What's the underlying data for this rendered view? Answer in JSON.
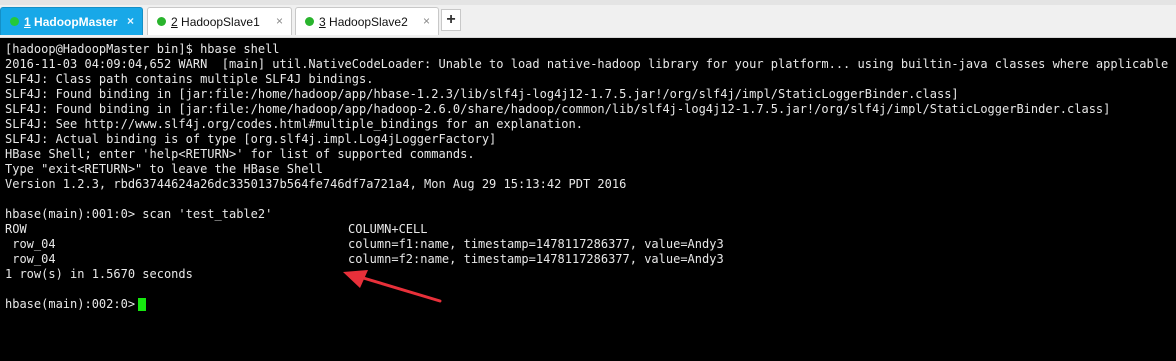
{
  "tabs": [
    {
      "num": "1",
      "name": " HadoopMaster"
    },
    {
      "num": "2",
      "name": " HadoopSlave1"
    },
    {
      "num": "3",
      "name": " HadoopSlave2"
    }
  ],
  "tab_close": "×",
  "new_tab": "+",
  "terminal": {
    "lines": [
      "[hadoop@HadoopMaster bin]$ hbase shell",
      "2016-11-03 04:09:04,652 WARN  [main] util.NativeCodeLoader: Unable to load native-hadoop library for your platform... using builtin-java classes where applicable",
      "SLF4J: Class path contains multiple SLF4J bindings.",
      "SLF4J: Found binding in [jar:file:/home/hadoop/app/hbase-1.2.3/lib/slf4j-log4j12-1.7.5.jar!/org/slf4j/impl/StaticLoggerBinder.class]",
      "SLF4J: Found binding in [jar:file:/home/hadoop/app/hadoop-2.6.0/share/hadoop/common/lib/slf4j-log4j12-1.7.5.jar!/org/slf4j/impl/StaticLoggerBinder.class]",
      "SLF4J: See http://www.slf4j.org/codes.html#multiple_bindings for an explanation.",
      "SLF4J: Actual binding is of type [org.slf4j.impl.Log4jLoggerFactory]",
      "HBase Shell; enter 'help<RETURN>' for list of supported commands.",
      "Type \"exit<RETURN>\" to leave the HBase Shell",
      "Version 1.2.3, rbd63744624a26dc3350137b564fe746df7a721a4, Mon Aug 29 15:13:42 PDT 2016",
      "hbase(main):001:0> scan 'test_table2'"
    ],
    "scan": {
      "header_row": "ROW",
      "header_cell": "COLUMN+CELL",
      "rows": [
        {
          "row": " row_04",
          "cell": "column=f1:name, timestamp=1478117286377, value=Andy3"
        },
        {
          "row": " row_04",
          "cell": "column=f2:name, timestamp=1478117286377, value=Andy3"
        }
      ],
      "summary": "1 row(s) in 1.5670 seconds"
    },
    "prompt": "hbase(main):002:0> "
  },
  "colors": {
    "background": "#000000",
    "text": "#e8e8e8",
    "cursor": "#16e80f",
    "active_tab": "#18a8e8",
    "tab_dot": "#29b42d",
    "arrow": "#e8303a"
  },
  "icons": [
    "status-dot-icon",
    "close-icon",
    "plus-icon",
    "red-arrow-annotation"
  ]
}
